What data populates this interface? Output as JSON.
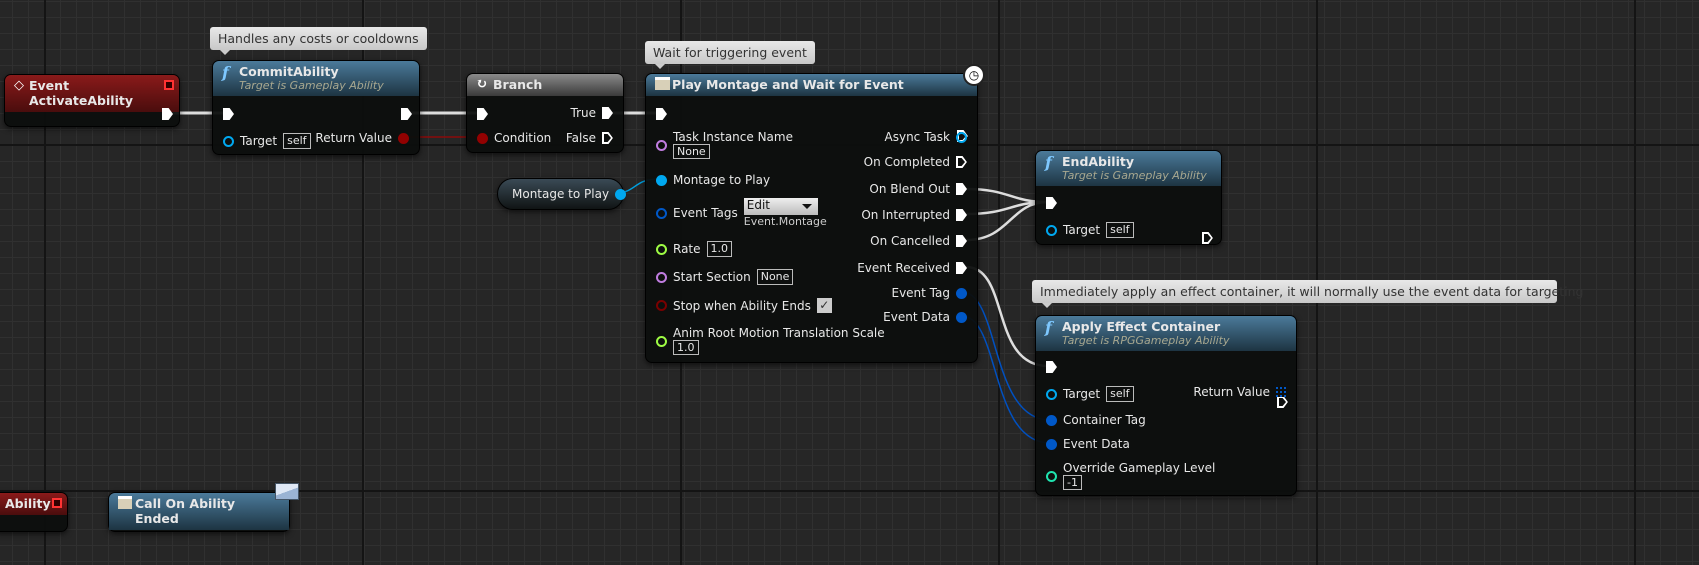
{
  "comments": {
    "commit": "Handles any costs or cooldowns",
    "montage": "Wait for triggering event",
    "apply": "Immediately apply an effect container, it will normally use the event data for targeting"
  },
  "event_node": {
    "title": "Event ActivateAbility",
    "icon": "event-diamond-icon"
  },
  "commit_node": {
    "title": "CommitAbility",
    "subtitle": "Target is Gameplay Ability",
    "target_label": "Target",
    "target_value": "self",
    "return_label": "Return Value"
  },
  "branch_node": {
    "title": "Branch",
    "condition": "Condition",
    "true_label": "True",
    "false_label": "False"
  },
  "montage_var": {
    "label": "Montage to Play"
  },
  "montage_node": {
    "title": "Play Montage and Wait for Event",
    "inputs": {
      "task_instance_name": "Task Instance Name",
      "task_instance_value": "None",
      "montage_to_play": "Montage to Play",
      "event_tags": "Event Tags",
      "event_tags_dropdown": "Edit",
      "event_tags_value": "Event.Montage",
      "rate": "Rate",
      "rate_value": "1.0",
      "start_section": "Start Section",
      "start_section_value": "None",
      "stop_when_ends": "Stop when Ability Ends",
      "stop_when_ends_checked": true,
      "anim_root": "Anim Root Motion Translation Scale",
      "anim_root_value": "1.0"
    },
    "outputs": {
      "async_task": "Async Task",
      "on_completed": "On Completed",
      "on_blend_out": "On Blend Out",
      "on_interrupted": "On Interrupted",
      "on_cancelled": "On Cancelled",
      "event_received": "Event Received",
      "event_tag": "Event Tag",
      "event_data": "Event Data"
    }
  },
  "end_node": {
    "title": "EndAbility",
    "subtitle": "Target is Gameplay Ability",
    "target_label": "Target",
    "target_value": "self"
  },
  "apply_node": {
    "title": "Apply Effect Container",
    "subtitle": "Target is RPGGameplay Ability",
    "target_label": "Target",
    "target_value": "self",
    "return_label": "Return Value",
    "container_tag": "Container Tag",
    "event_data": "Event Data",
    "override_level": "Override Gameplay Level",
    "override_level_value": "-1"
  },
  "bottom": {
    "partial_event": "Ability",
    "call_node": "Call On Ability Ended"
  },
  "colors": {
    "exec": "#ffffff",
    "object": "#00a8f0",
    "struct": "#0058c8",
    "bool": "#920101",
    "name": "#c07de0",
    "float": "#9efc44",
    "int": "#1fe3af"
  }
}
